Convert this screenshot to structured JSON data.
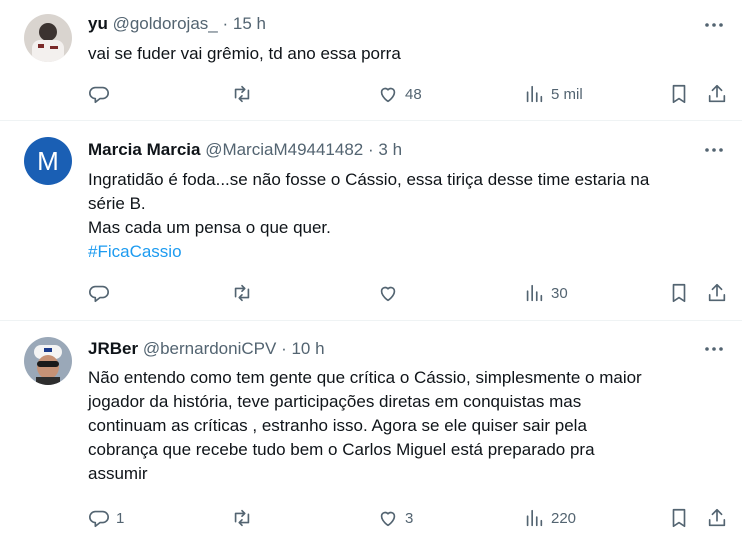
{
  "tweets": [
    {
      "name": "yu",
      "handle": "@goldorojas_",
      "separator": "·",
      "time": "15 h",
      "text_lines": [
        "vai se fuder vai grêmio, td ano essa porra"
      ],
      "hashtag": "",
      "replies": "",
      "retweets": "",
      "likes": "48",
      "views": "5 mil",
      "avatar_icon": "photo-avatar"
    },
    {
      "name": "Marcia Marcia",
      "handle": "@MarciaM49441482",
      "separator": "·",
      "time": "3 h",
      "avatar_letter": "M",
      "text_lines": [
        "Ingratidão é foda...se não fosse o Cássio, essa tiriça desse time estaria na",
        "série B.",
        "Mas cada um pensa o que quer."
      ],
      "hashtag": "#FicaCassio",
      "replies": "",
      "retweets": "",
      "likes": "",
      "views": "30"
    },
    {
      "name": "JRBer",
      "handle": "@bernardoniCPV",
      "separator": "·",
      "time": "10 h",
      "text_lines": [
        "Não entendo como tem gente que crítica o Cássio, simplesmente o maior",
        "jogador da história, teve participações diretas em conquistas mas",
        "continuam as críticas , estranho isso. Agora se ele quiser sair pela",
        "cobrança que recebe tudo bem o Carlos Miguel está preparado pra",
        "assumir"
      ],
      "hashtag": "",
      "replies": "1",
      "retweets": "",
      "likes": "3",
      "views": "220",
      "avatar_icon": "photo-avatar"
    }
  ],
  "colors": {
    "accent": "#1d9bf0",
    "muted": "#536471",
    "text": "#0f1419",
    "avatar_m": "#1a5fb4"
  }
}
